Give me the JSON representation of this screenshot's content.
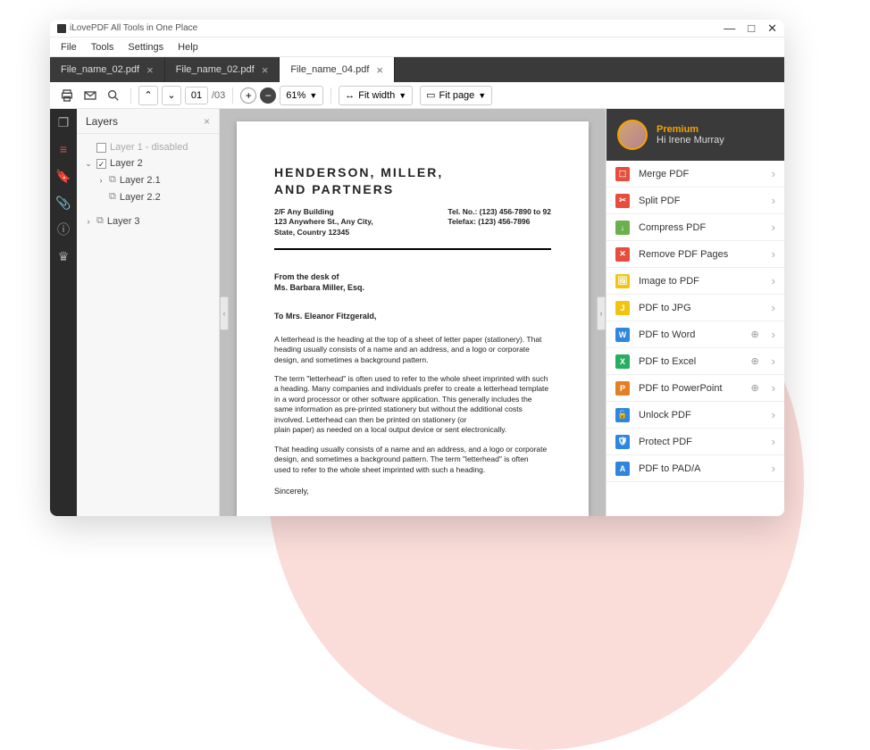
{
  "window": {
    "title": "iLovePDF All Tools in One Place"
  },
  "menubar": [
    "File",
    "Tools",
    "Settings",
    "Help"
  ],
  "tabs": [
    {
      "label": "File_name_02.pdf",
      "active": false
    },
    {
      "label": "File_name_02.pdf",
      "active": false
    },
    {
      "label": "File_name_04.pdf",
      "active": true
    }
  ],
  "toolbar": {
    "page_current": "01",
    "page_total": "/03",
    "zoom": "61%",
    "fit_width": "Fit width",
    "fit_page": "Fit page"
  },
  "layers_panel": {
    "title": "Layers",
    "items": [
      {
        "label": "Layer 1 - disabled",
        "checked": false,
        "disabled": true,
        "indent": 0,
        "expandable": false,
        "icon": false
      },
      {
        "label": "Layer 2",
        "checked": true,
        "disabled": false,
        "indent": 0,
        "expandable": true,
        "icon": false
      },
      {
        "label": "Layer 2.1",
        "checked": null,
        "disabled": false,
        "indent": 1,
        "expandable": true,
        "icon": true
      },
      {
        "label": "Layer 2.2",
        "checked": null,
        "disabled": false,
        "indent": 2,
        "expandable": false,
        "icon": true
      },
      {
        "label": "Layer 3",
        "checked": null,
        "disabled": false,
        "indent": 0,
        "expandable": true,
        "icon": true
      }
    ]
  },
  "document": {
    "title_line1": "HENDERSON, MILLER,",
    "title_line2": "AND PARTNERS",
    "addr1": "2/F Any Building",
    "addr2": "123 Anywhere St., Any City,",
    "addr3": "State, Country 12345",
    "tel": "Tel. No.: (123) 456-7890 to 92",
    "fax": "Telefax: (123) 456-7896",
    "desk1": "From the desk of",
    "desk2": "Ms. Barbara Miller, Esq.",
    "to": "To Mrs. Eleanor Fitzgerald,",
    "p1": "A letterhead is the heading at the top of a sheet of letter paper (stationery). That heading usually consists of a name and an address, and a logo or corporate design, and sometimes a background pattern.",
    "p2": "The term \"letterhead\" is often used to refer to the whole sheet imprinted with such a heading. Many companies and individuals prefer to create a letterhead template in a word processor or other software application. This generally includes the same information as pre-printed stationery but without the additional costs involved. Letterhead can then be printed on stationery (or",
    "p3": "plain paper) as needed on a local output device or sent electronically.",
    "p4": "That heading usually consists of a name and an address, and a logo or corporate design, and sometimes a background pattern. The term \"letterhead\" is often",
    "p5": "used to refer to the whole sheet imprinted with such a heading.",
    "sig": "Sincerely,"
  },
  "account": {
    "tier": "Premium",
    "greeting": "Hi Irene Murray"
  },
  "tools": [
    {
      "label": "Merge PDF",
      "color": "#e74c3c",
      "glyph": "⬚",
      "globe": false
    },
    {
      "label": "Split PDF",
      "color": "#e74c3c",
      "glyph": "✂",
      "globe": false
    },
    {
      "label": "Compress PDF",
      "color": "#6ab04c",
      "glyph": "↓",
      "globe": false
    },
    {
      "label": "Remove PDF Pages",
      "color": "#e74c3c",
      "glyph": "✕",
      "globe": false
    },
    {
      "label": "Image to PDF",
      "color": "#f1c40f",
      "glyph": "🖼",
      "globe": false
    },
    {
      "label": "PDF to JPG",
      "color": "#f1c40f",
      "glyph": "J",
      "globe": false
    },
    {
      "label": "PDF to Word",
      "color": "#2e86de",
      "glyph": "W",
      "globe": true
    },
    {
      "label": "PDF to Excel",
      "color": "#27ae60",
      "glyph": "X",
      "globe": true
    },
    {
      "label": "PDF to PowerPoint",
      "color": "#e67e22",
      "glyph": "P",
      "globe": true
    },
    {
      "label": "Unlock PDF",
      "color": "#2e86de",
      "glyph": "🔓",
      "globe": false
    },
    {
      "label": "Protect PDF",
      "color": "#2e86de",
      "glyph": "🛡",
      "globe": false
    },
    {
      "label": "PDF to PAD/A",
      "color": "#2e86de",
      "glyph": "A",
      "globe": false
    }
  ]
}
